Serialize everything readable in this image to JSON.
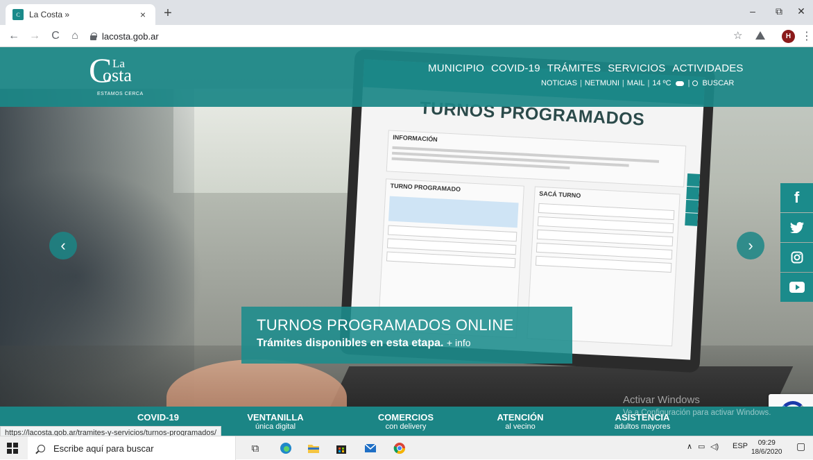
{
  "browser": {
    "tab_title": "La Costa »",
    "tab_close": "×",
    "new_tab": "+",
    "url": "lacosta.gob.ar",
    "profile_initial": "H",
    "window_controls": [
      "–",
      "⧉",
      "✕"
    ],
    "status_url": "https://lacosta.gob.ar/tramites-y-servicios/turnos-programados/"
  },
  "site": {
    "logo": {
      "c": "C",
      "la": "La",
      "osta": "osta",
      "tagline": "ESTAMOS CERCA"
    },
    "main_nav": [
      "MUNICIPIO",
      "COVID-19",
      "TRÁMITES",
      "SERVICIOS",
      "ACTIVIDADES"
    ],
    "sub_nav": {
      "noticias": "NOTICIAS",
      "netmuni": "NETMUNI",
      "mail": "MAIL",
      "weather": "14 ºC",
      "buscar": "BUSCAR"
    },
    "hero_screen_title": "TURNOS PROGRAMADOS",
    "banner": {
      "title": "TURNOS PROGRAMADOS ONLINE",
      "subtitle": "Trámites disponibles en esta etapa.",
      "info_link": "+ info"
    },
    "carousel": {
      "prev": "‹",
      "next": "›"
    },
    "social": [
      "facebook-icon",
      "twitter-icon",
      "instagram-icon",
      "youtube-icon"
    ],
    "bottom_bar": [
      {
        "title": "COVID-19",
        "sub": ""
      },
      {
        "title": "VENTANILLA",
        "sub": "única digital"
      },
      {
        "title": "COMERCIOS",
        "sub": "con delivery"
      },
      {
        "title": "ATENCIÓN",
        "sub": "al vecino"
      },
      {
        "title": "ASISTENCIA",
        "sub": "adultos mayores"
      }
    ],
    "watermark": {
      "line1": "Activar Windows",
      "line2": "Ve a Configuración para activar Windows."
    }
  },
  "taskbar": {
    "search_placeholder": "Escribe aquí para buscar",
    "language": "ESP",
    "time": "09:29",
    "date": "18/6/2020"
  }
}
